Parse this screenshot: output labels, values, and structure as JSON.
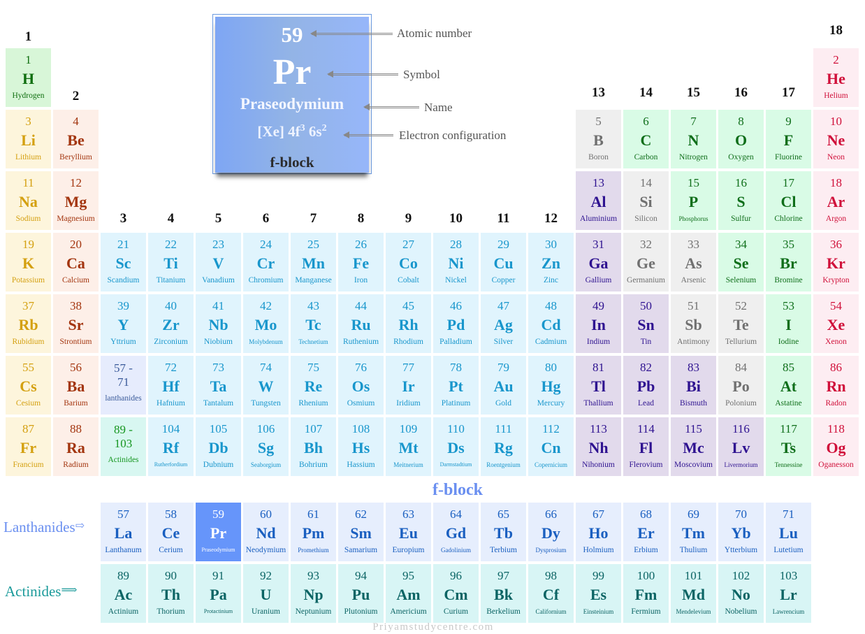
{
  "categories": {
    "h": {
      "bg": "#d8f6d8",
      "fg": "#0f6e0f"
    },
    "al": {
      "bg": "#fdf5dc",
      "fg": "#d4a010"
    },
    "ae": {
      "bg": "#fdefe8",
      "fg": "#a3350f"
    },
    "tm": {
      "bg": "#e0f4fd",
      "fg": "#1896cc"
    },
    "pt": {
      "bg": "#e2daec",
      "fg": "#2e1290"
    },
    "md": {
      "bg": "#efefef",
      "fg": "#707070"
    },
    "nm": {
      "bg": "#d9fbe6",
      "fg": "#0f6e1a"
    },
    "ng": {
      "bg": "#fdedf2",
      "fg": "#d0103a"
    },
    "la": {
      "bg": "#e6eefd",
      "fg": "#1a5fc0"
    },
    "ac": {
      "bg": "#d8f5f5",
      "fg": "#0b6464"
    },
    "phla": {
      "bg": "#e6ecfd",
      "fg": "#3a5a9a"
    },
    "phac": {
      "bg": "#d8f7f1",
      "fg": "#15961f"
    },
    "hl": {
      "bg": "#6695fa",
      "fg": "#ffffff"
    }
  },
  "group_labels": [
    "1",
    "2",
    "3",
    "4",
    "5",
    "6",
    "7",
    "8",
    "9",
    "10",
    "11",
    "12",
    "13",
    "14",
    "15",
    "16",
    "17",
    "18"
  ],
  "periods": [
    [
      [
        1,
        "H",
        "Hydrogen",
        "h",
        1
      ],
      [
        2,
        "He",
        "Helium",
        "ng",
        18
      ]
    ],
    [
      [
        3,
        "Li",
        "Lithium",
        "al",
        1
      ],
      [
        4,
        "Be",
        "Beryllium",
        "ae"
      ],
      [
        5,
        "B",
        "Boron",
        "md",
        13
      ],
      [
        6,
        "C",
        "Carbon",
        "nm"
      ],
      [
        7,
        "N",
        "Nitrogen",
        "nm"
      ],
      [
        8,
        "O",
        "Oxygen",
        "nm"
      ],
      [
        9,
        "F",
        "Fluorine",
        "nm"
      ],
      [
        10,
        "Ne",
        "Neon",
        "ng"
      ]
    ],
    [
      [
        11,
        "Na",
        "Sodium",
        "al",
        1
      ],
      [
        12,
        "Mg",
        "Magnesium",
        "ae"
      ],
      [
        13,
        "Al",
        "Aluminium",
        "pt",
        13
      ],
      [
        14,
        "Si",
        "Silicon",
        "md"
      ],
      [
        15,
        "P",
        "Phosphorus",
        "nm"
      ],
      [
        16,
        "S",
        "Sulfur",
        "nm"
      ],
      [
        17,
        "Cl",
        "Chlorine",
        "nm"
      ],
      [
        18,
        "Ar",
        "Argon",
        "ng"
      ]
    ],
    [
      [
        19,
        "K",
        "Potassium",
        "al"
      ],
      [
        20,
        "Ca",
        "Calcium",
        "ae"
      ],
      [
        21,
        "Sc",
        "Scandium",
        "tm"
      ],
      [
        22,
        "Ti",
        "Titanium",
        "tm"
      ],
      [
        23,
        "V",
        "Vanadium",
        "tm"
      ],
      [
        24,
        "Cr",
        "Chromium",
        "tm"
      ],
      [
        25,
        "Mn",
        "Manganese",
        "tm"
      ],
      [
        26,
        "Fe",
        "Iron",
        "tm"
      ],
      [
        27,
        "Co",
        "Cobalt",
        "tm"
      ],
      [
        28,
        "Ni",
        "Nickel",
        "tm"
      ],
      [
        29,
        "Cu",
        "Copper",
        "tm"
      ],
      [
        30,
        "Zn",
        "Zinc",
        "tm"
      ],
      [
        31,
        "Ga",
        "Gallium",
        "pt"
      ],
      [
        32,
        "Ge",
        "Germanium",
        "md"
      ],
      [
        33,
        "As",
        "Arsenic",
        "md"
      ],
      [
        34,
        "Se",
        "Selenium",
        "nm"
      ],
      [
        35,
        "Br",
        "Bromine",
        "nm"
      ],
      [
        36,
        "Kr",
        "Krypton",
        "ng"
      ]
    ],
    [
      [
        37,
        "Rb",
        "Rubidium",
        "al"
      ],
      [
        38,
        "Sr",
        "Strontium",
        "ae"
      ],
      [
        39,
        "Y",
        "Yttrium",
        "tm"
      ],
      [
        40,
        "Zr",
        "Zirconium",
        "tm"
      ],
      [
        41,
        "Nb",
        "Niobium",
        "tm"
      ],
      [
        42,
        "Mo",
        "Molybdenum",
        "tm"
      ],
      [
        43,
        "Tc",
        "Technetium",
        "tm"
      ],
      [
        44,
        "Ru",
        "Ruthenium",
        "tm"
      ],
      [
        45,
        "Rh",
        "Rhodium",
        "tm"
      ],
      [
        46,
        "Pd",
        "Palladium",
        "tm"
      ],
      [
        47,
        "Ag",
        "Silver",
        "tm"
      ],
      [
        48,
        "Cd",
        "Cadmium",
        "tm"
      ],
      [
        49,
        "In",
        "Indium",
        "pt"
      ],
      [
        50,
        "Sn",
        "Tin",
        "pt"
      ],
      [
        51,
        "Sb",
        "Antimony",
        "md"
      ],
      [
        52,
        "Te",
        "Tellurium",
        "md"
      ],
      [
        53,
        "I",
        "Iodine",
        "nm"
      ],
      [
        54,
        "Xe",
        "Xenon",
        "ng"
      ]
    ],
    [
      [
        55,
        "Cs",
        "Cesium",
        "al"
      ],
      [
        56,
        "Ba",
        "Barium",
        "ae"
      ],
      [
        "57 -",
        "71",
        "lanthanides",
        "phla"
      ],
      [
        72,
        "Hf",
        "Hafnium",
        "tm"
      ],
      [
        73,
        "Ta",
        "Tantalum",
        "tm"
      ],
      [
        74,
        "W",
        "Tungsten",
        "tm"
      ],
      [
        75,
        "Re",
        "Rhenium",
        "tm"
      ],
      [
        76,
        "Os",
        "Osmium",
        "tm"
      ],
      [
        77,
        "Ir",
        "Iridium",
        "tm"
      ],
      [
        78,
        "Pt",
        "Platinum",
        "tm"
      ],
      [
        79,
        "Au",
        "Gold",
        "tm"
      ],
      [
        80,
        "Hg",
        "Mercury",
        "tm"
      ],
      [
        81,
        "Tl",
        "Thallium",
        "pt"
      ],
      [
        82,
        "Pb",
        "Lead",
        "pt"
      ],
      [
        83,
        "Bi",
        "Bismuth",
        "pt"
      ],
      [
        84,
        "Po",
        "Polonium",
        "md"
      ],
      [
        85,
        "At",
        "Astatine",
        "nm"
      ],
      [
        86,
        "Rn",
        "Radon",
        "ng"
      ]
    ],
    [
      [
        87,
        "Fr",
        "Francium",
        "al"
      ],
      [
        88,
        "Ra",
        "Radium",
        "ae"
      ],
      [
        "89 -",
        "103",
        "Actinides",
        "phac"
      ],
      [
        104,
        "Rf",
        "Rutherfordium",
        "tm"
      ],
      [
        105,
        "Db",
        "Dubnium",
        "tm"
      ],
      [
        106,
        "Sg",
        "Seaborgium",
        "tm"
      ],
      [
        107,
        "Bh",
        "Bohrium",
        "tm"
      ],
      [
        108,
        "Hs",
        "Hassium",
        "tm"
      ],
      [
        109,
        "Mt",
        "Meitnerium",
        "tm"
      ],
      [
        110,
        "Ds",
        "Darmstadtium",
        "tm"
      ],
      [
        111,
        "Rg",
        "Roentgenium",
        "tm"
      ],
      [
        112,
        "Cn",
        "Copernicium",
        "tm"
      ],
      [
        113,
        "Nh",
        "Nihonium",
        "pt"
      ],
      [
        114,
        "Fl",
        "Flerovium",
        "pt"
      ],
      [
        115,
        "Mc",
        "Moscovium",
        "pt"
      ],
      [
        116,
        "Lv",
        "Livermorium",
        "pt"
      ],
      [
        117,
        "Ts",
        "Tennessine",
        "nm"
      ],
      [
        118,
        "Og",
        "Oganesson",
        "ng"
      ]
    ]
  ],
  "lanthanides": [
    [
      57,
      "La",
      "Lanthanum",
      "la"
    ],
    [
      58,
      "Ce",
      "Cerium",
      "la"
    ],
    [
      59,
      "Pr",
      "Praseodymium",
      "hl"
    ],
    [
      60,
      "Nd",
      "Neodymium",
      "la"
    ],
    [
      61,
      "Pm",
      "Promethium",
      "la"
    ],
    [
      62,
      "Sm",
      "Samarium",
      "la"
    ],
    [
      63,
      "Eu",
      "Europium",
      "la"
    ],
    [
      64,
      "Gd",
      "Gadolinium",
      "la"
    ],
    [
      65,
      "Tb",
      "Terbium",
      "la"
    ],
    [
      66,
      "Dy",
      "Dysprosium",
      "la"
    ],
    [
      67,
      "Ho",
      "Holmium",
      "la"
    ],
    [
      68,
      "Er",
      "Erbium",
      "la"
    ],
    [
      69,
      "Tm",
      "Thulium",
      "la"
    ],
    [
      70,
      "Yb",
      "Ytterbium",
      "la"
    ],
    [
      71,
      "Lu",
      "Lutetium",
      "la"
    ]
  ],
  "actinides": [
    [
      89,
      "Ac",
      "Actinium",
      "ac"
    ],
    [
      90,
      "Th",
      "Thorium",
      "ac"
    ],
    [
      91,
      "Pa",
      "Protactinium",
      "ac"
    ],
    [
      92,
      "U",
      "Uranium",
      "ac"
    ],
    [
      93,
      "Np",
      "Neptunium",
      "ac"
    ],
    [
      94,
      "Pu",
      "Plutonium",
      "ac"
    ],
    [
      95,
      "Am",
      "Americium",
      "ac"
    ],
    [
      96,
      "Cm",
      "Curium",
      "ac"
    ],
    [
      97,
      "Bk",
      "Berkelium",
      "ac"
    ],
    [
      98,
      "Cf",
      "Californium",
      "ac"
    ],
    [
      99,
      "Es",
      "Einsteinium",
      "ac"
    ],
    [
      100,
      "Fm",
      "Fermium",
      "ac"
    ],
    [
      101,
      "Md",
      "Mendelevium",
      "ac"
    ],
    [
      102,
      "No",
      "Nobelium",
      "ac"
    ],
    [
      103,
      "Lr",
      "Lawrencium",
      "ac"
    ]
  ],
  "infobox": {
    "number": "59",
    "symbol": "Pr",
    "name": "Praseodymium",
    "config_prefix": "[Xe] 4f",
    "config_sup1": "3",
    "config_mid": " 6s",
    "config_sup2": "2",
    "block": "f-block",
    "labels": {
      "number": "Atomic number",
      "symbol": "Symbol",
      "name": "Name",
      "config": "Electron configuration"
    }
  },
  "fblock_title": "f-block",
  "lanthanides_label": "Lanthanides",
  "actinides_label": "Actinides",
  "arrow_lan": "⇨",
  "arrow_act": "⟹",
  "watermark": "Priyamstudycentre.com"
}
